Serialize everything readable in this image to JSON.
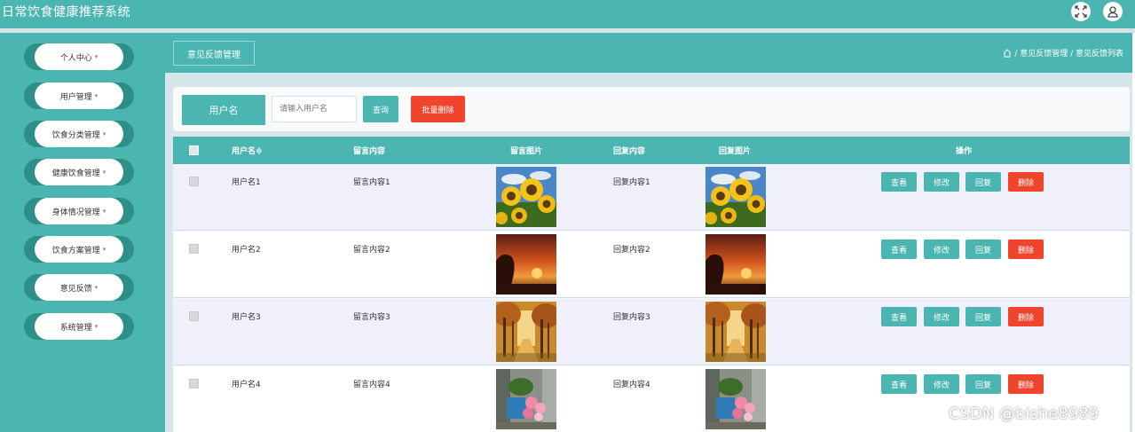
{
  "app": {
    "title": "日常饮食健康推荐系统"
  },
  "topbar": {
    "fullscreen_icon": "fullscreen-icon",
    "user_icon": "user-icon"
  },
  "sidebar": {
    "items": [
      {
        "label": "个人中心"
      },
      {
        "label": "用户管理"
      },
      {
        "label": "饮食分类管理"
      },
      {
        "label": "健康饮食管理"
      },
      {
        "label": "身体情况管理"
      },
      {
        "label": "饮食方案管理"
      },
      {
        "label": "意见反馈"
      },
      {
        "label": "系统管理"
      }
    ],
    "caret": "▾"
  },
  "header": {
    "page_button": "意见反馈管理",
    "breadcrumb": "/ 意见反馈管理 / 意见反馈列表"
  },
  "search": {
    "label": "用户名",
    "placeholder": "请输入用户名",
    "query_label": "查询",
    "batch_delete_label": "批量删除"
  },
  "table": {
    "columns": [
      "用户名≑",
      "留言内容",
      "留言图片",
      "回复内容",
      "回复图片",
      "操作"
    ],
    "rows": [
      {
        "username": "用户名1",
        "message": "留言内容1",
        "reply": "回复内容1",
        "image": "sunflower"
      },
      {
        "username": "用户名2",
        "message": "留言内容2",
        "reply": "回复内容2",
        "image": "sunset"
      },
      {
        "username": "用户名3",
        "message": "留言内容3",
        "reply": "回复内容3",
        "image": "autumn-forest"
      },
      {
        "username": "用户名4",
        "message": "留言内容4",
        "reply": "回复内容4",
        "image": "flower-pot"
      }
    ],
    "actions": {
      "view": "查看",
      "edit": "修改",
      "reply": "回复",
      "delete": "删除"
    }
  },
  "colors": {
    "primary": "#4ab5b1",
    "dark_teal": "#2d8f87",
    "danger": "#f0442d",
    "content_bg": "#d6e6ea"
  },
  "watermark": "CSDN @bishe8989"
}
